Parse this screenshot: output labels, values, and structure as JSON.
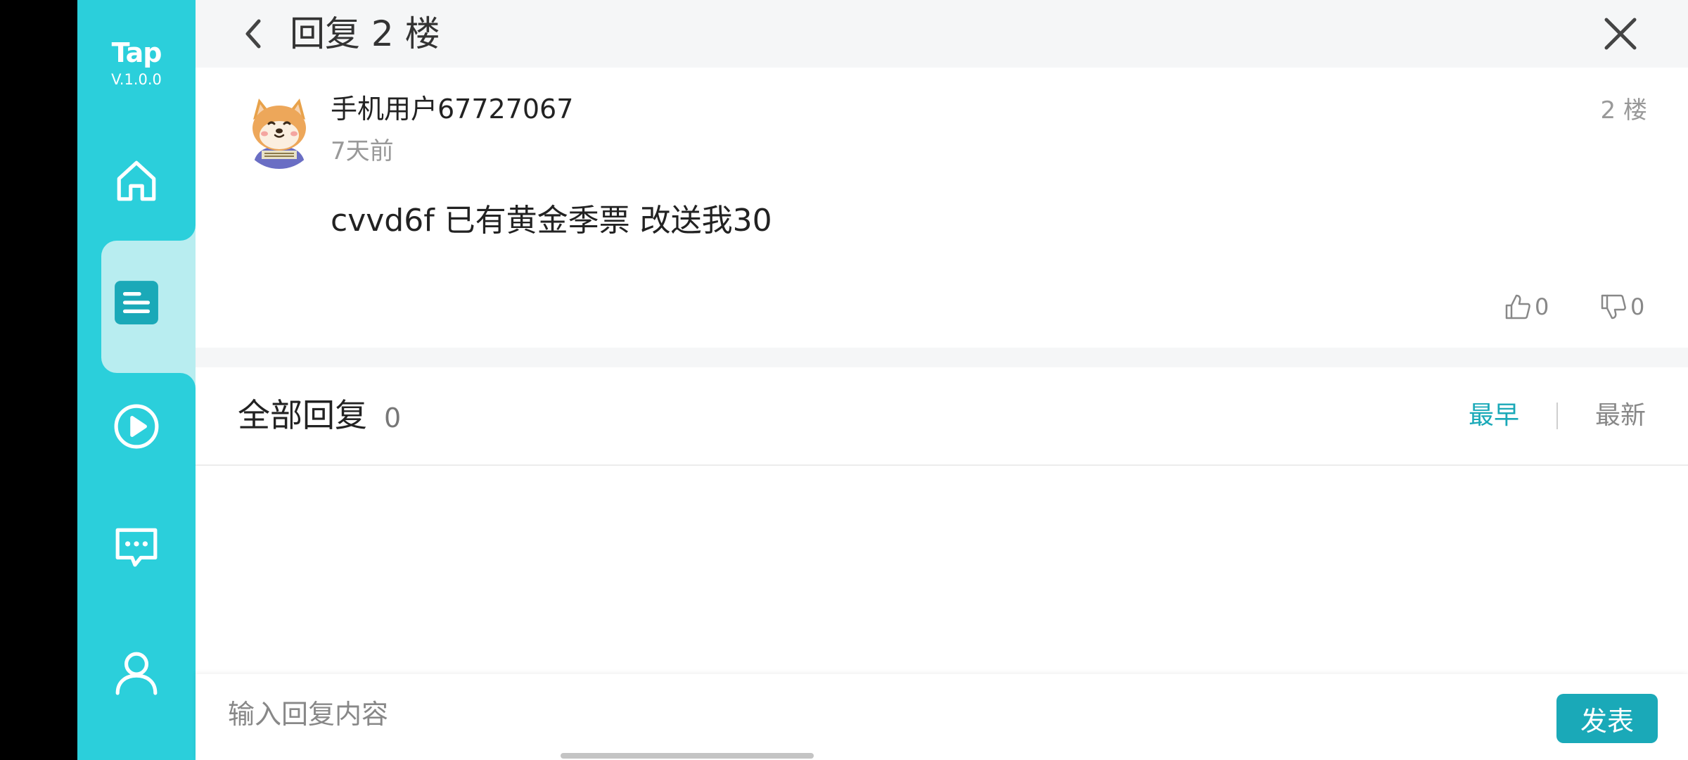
{
  "app": {
    "brand_name": "Tap",
    "version": "V.1.0.0",
    "accent_color": "#2bcfdb",
    "button_color": "#1aa9b8"
  },
  "sidebar": {
    "items": [
      {
        "id": "home",
        "icon": "home-icon",
        "active": false
      },
      {
        "id": "forum",
        "icon": "forum-list-icon",
        "active": true
      },
      {
        "id": "video",
        "icon": "play-icon",
        "active": false
      },
      {
        "id": "messages",
        "icon": "chat-icon",
        "active": false
      },
      {
        "id": "profile",
        "icon": "user-icon",
        "active": false
      }
    ]
  },
  "header": {
    "title": "回复 2 楼",
    "back_icon": "chevron-left-icon",
    "close_icon": "close-icon"
  },
  "post": {
    "username": "手机用户67727067",
    "time": "7天前",
    "floor": "2 楼",
    "content": "cvvd6f 已有黄金季票 改送我30",
    "likes": "0",
    "dislikes": "0"
  },
  "replies": {
    "title": "全部回复",
    "count": "0",
    "sort_earliest": "最早",
    "sort_newest": "最新",
    "active_sort": "earliest"
  },
  "composer": {
    "placeholder": "输入回复内容",
    "value": "",
    "send_label": "发表"
  }
}
